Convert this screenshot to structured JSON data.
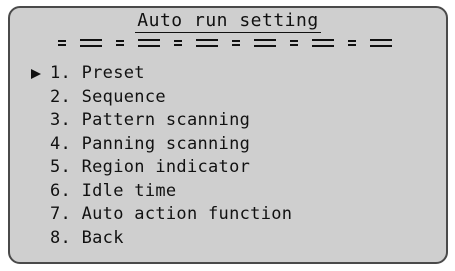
{
  "title": "Auto run setting",
  "selected_index": 0,
  "cursor_icon": "right-triangle-icon",
  "menu": [
    {
      "label": "1. Preset"
    },
    {
      "label": "2. Sequence"
    },
    {
      "label": "3. Pattern scanning"
    },
    {
      "label": "4. Panning scanning"
    },
    {
      "label": "5. Region indicator"
    },
    {
      "label": "6. Idle time"
    },
    {
      "label": "7. Auto action function"
    },
    {
      "label": "8. Back"
    }
  ],
  "colors": {
    "screen_bg": "#cfcfcf",
    "text": "#111111",
    "border": "#4a4a4a"
  }
}
